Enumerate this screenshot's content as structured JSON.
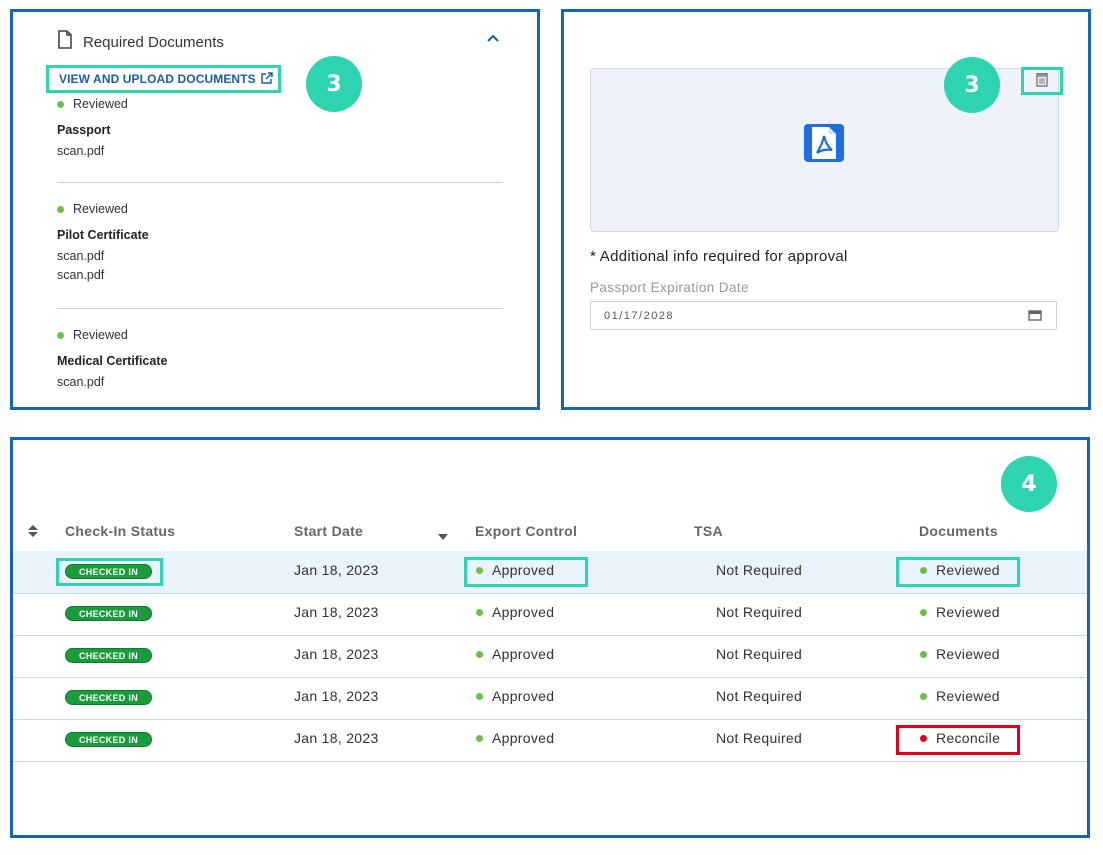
{
  "docs_panel": {
    "title": "Required Documents",
    "upload_link": "VIEW AND UPLOAD DOCUMENTS",
    "callout": "3",
    "documents": [
      {
        "status": "Reviewed",
        "name": "Passport",
        "files": [
          "scan.pdf"
        ]
      },
      {
        "status": "Reviewed",
        "name": "Pilot Certificate",
        "files": [
          "scan.pdf",
          "scan.pdf"
        ]
      },
      {
        "status": "Reviewed",
        "name": "Medical Certificate",
        "files": [
          "scan.pdf"
        ]
      }
    ]
  },
  "preview_panel": {
    "callout": "3",
    "required_note": "* Additional info required for approval",
    "expiration_label": "Passport Expiration Date",
    "expiration_value": "01/17/2028"
  },
  "table_panel": {
    "callout": "4",
    "headers": {
      "check_in": "Check-In Status",
      "start_date": "Start Date",
      "export_control": "Export Control",
      "tsa": "TSA",
      "documents": "Documents"
    },
    "rows": [
      {
        "check_in": "CHECKED IN",
        "start_date": "Jan 18, 2023",
        "export_control": "Approved",
        "tsa": "Not Required",
        "documents": "Reviewed",
        "doc_color": "#6cc04a"
      },
      {
        "check_in": "CHECKED IN",
        "start_date": "Jan 18, 2023",
        "export_control": "Approved",
        "tsa": "Not Required",
        "documents": "Reviewed",
        "doc_color": "#6cc04a"
      },
      {
        "check_in": "CHECKED IN",
        "start_date": "Jan 18, 2023",
        "export_control": "Approved",
        "tsa": "Not Required",
        "documents": "Reviewed",
        "doc_color": "#6cc04a"
      },
      {
        "check_in": "CHECKED IN",
        "start_date": "Jan 18, 2023",
        "export_control": "Approved",
        "tsa": "Not Required",
        "documents": "Reviewed",
        "doc_color": "#6cc04a"
      },
      {
        "check_in": "CHECKED IN",
        "start_date": "Jan 18, 2023",
        "export_control": "Approved",
        "tsa": "Not Required",
        "documents": "Reconcile",
        "doc_color": "#e0001b"
      }
    ]
  },
  "colors": {
    "accent_border": "#1565b8",
    "callout": "#2ed3b0",
    "approved": "#6cc04a",
    "reconcile": "#e0001b",
    "checked_in": "#1a9b3c"
  },
  "icons": [
    "document-icon",
    "chevron-up-icon",
    "external-link-icon",
    "pdf-icon",
    "trash-icon",
    "calendar-icon",
    "sort-icon",
    "sort-down-icon"
  ]
}
